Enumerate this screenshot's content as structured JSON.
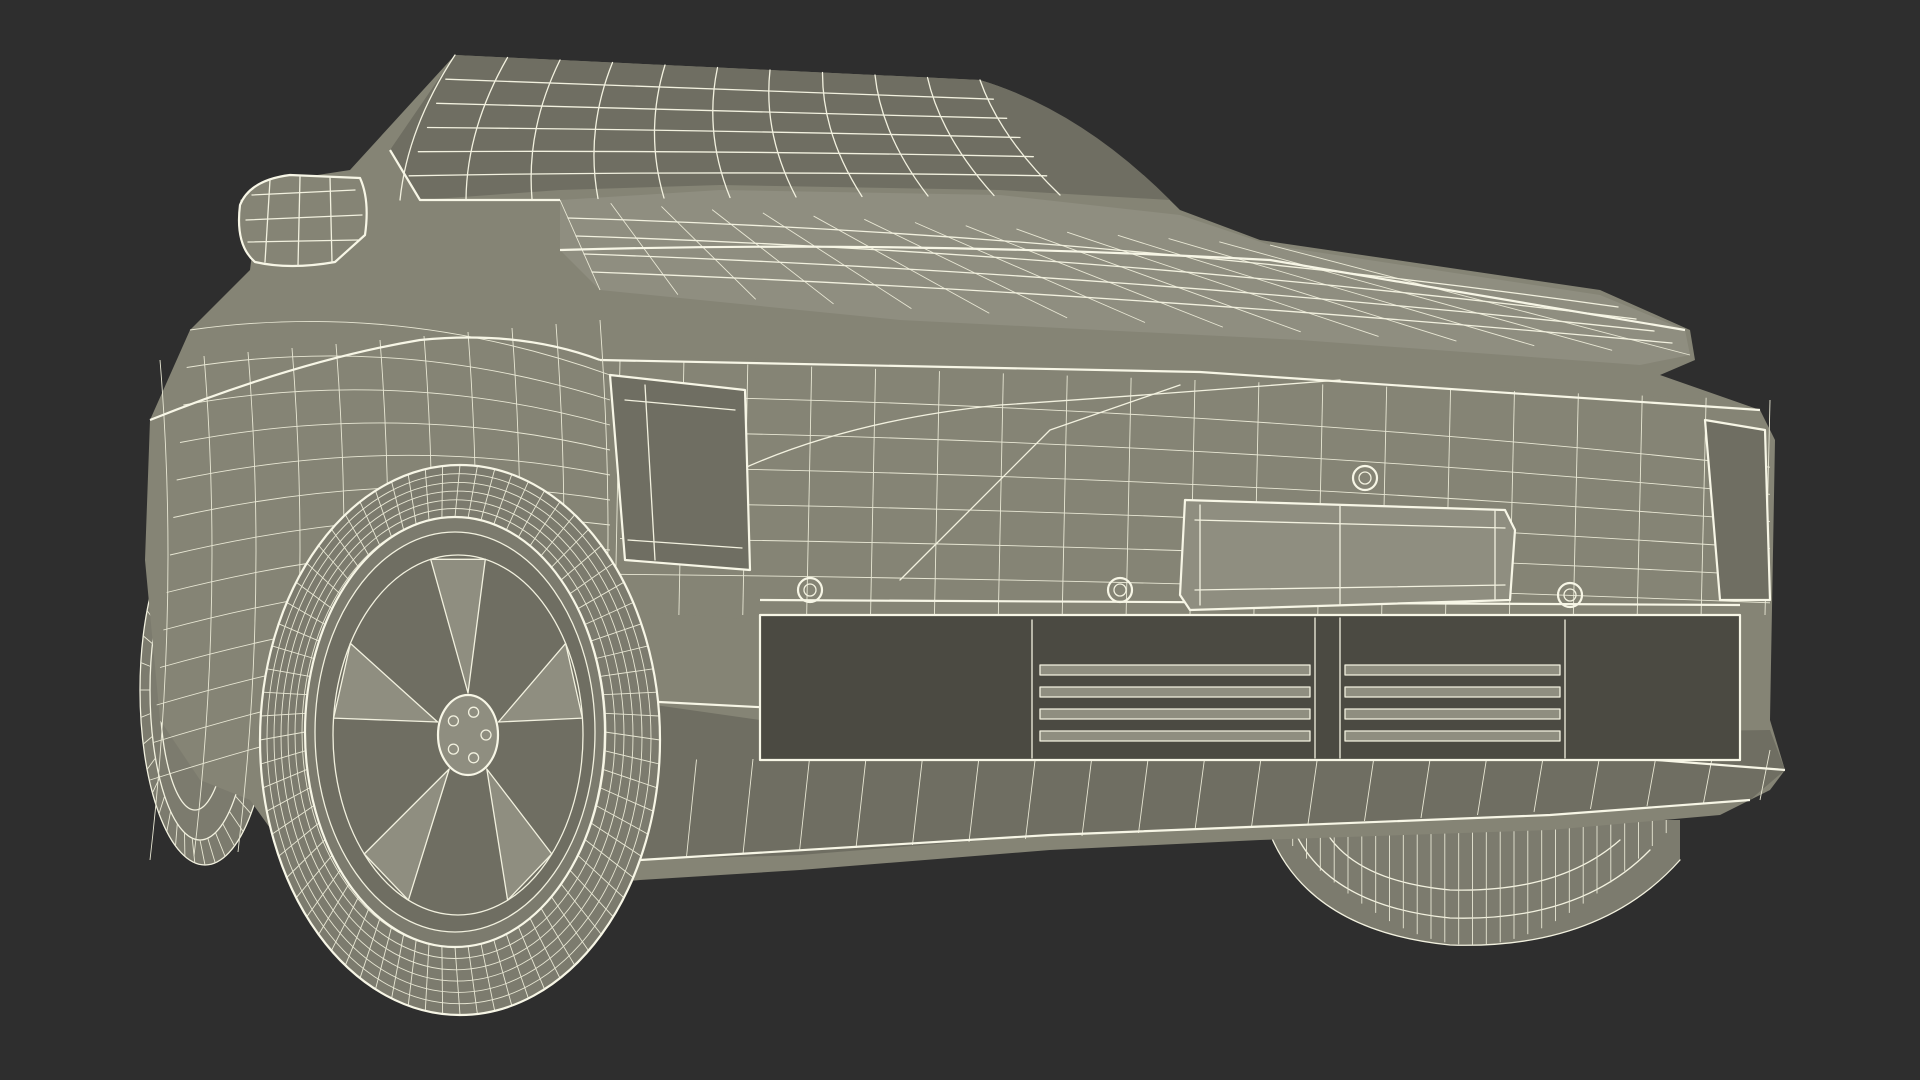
{
  "scene": {
    "subject": "car-wireframe-render",
    "colors": {
      "background": "#2e2e2e",
      "surface": "#858475",
      "wire": "#f2f1df"
    }
  }
}
